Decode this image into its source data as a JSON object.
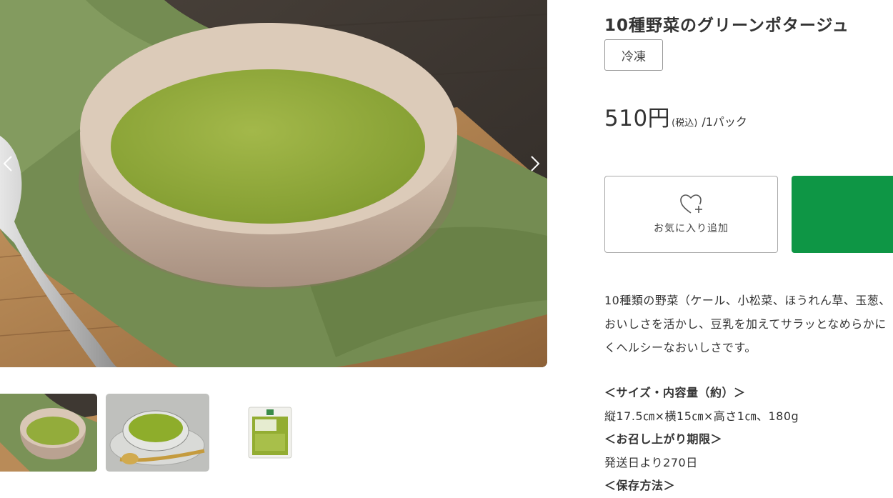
{
  "product": {
    "title": "10種野菜のグリーンポタージュ",
    "tag": "冷凍",
    "price_amount": "510円",
    "price_tax": "(税込)",
    "price_unit": "/1パック"
  },
  "actions": {
    "favorite_label": "お気に入り追加",
    "cart_color": "#0e9645"
  },
  "gallery": {
    "prev_icon": "chevron-left-icon",
    "next_icon": "chevron-right-icon",
    "thumbnail_count": 3
  },
  "description": [
    "10種類の野菜（ケール、小松菜、ほうれん草、玉葱、",
    "おいしさを活かし、豆乳を加えてサラッとなめらかに",
    "くヘルシーなおいしさです。"
  ],
  "specs": {
    "size_heading": "＜サイズ・内容量（約）＞",
    "size_value": "縦17.5㎝×横15㎝×高さ1㎝、180g",
    "expiry_heading": "＜お召し上がり期限＞",
    "expiry_value": "発送日より270日",
    "storage_heading": "＜保存方法＞"
  }
}
